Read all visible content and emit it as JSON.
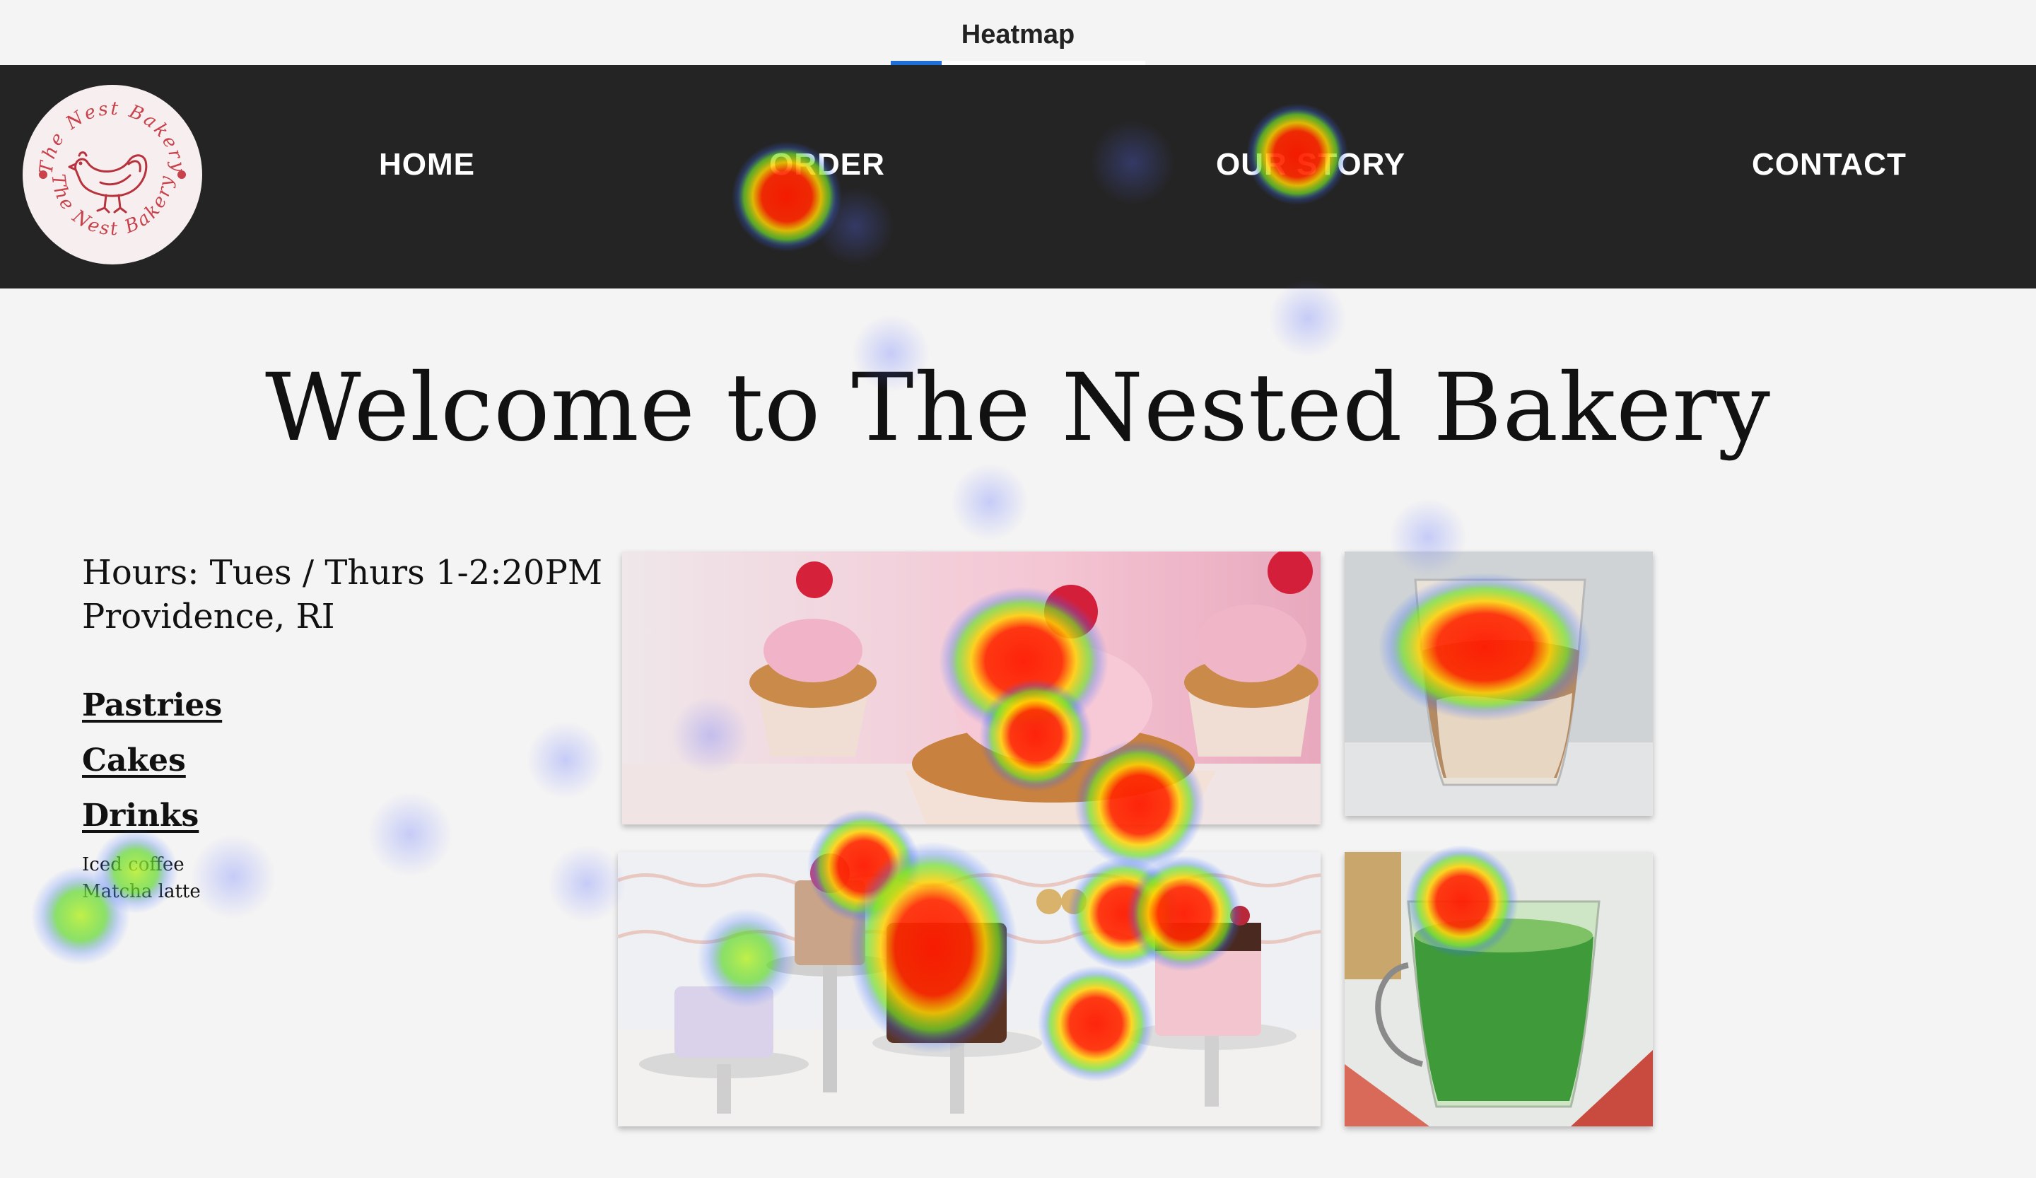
{
  "window": {
    "title": "Heatmap"
  },
  "nav": {
    "logo_text": "The Nest Bakery",
    "items": [
      "HOME",
      "ORDER",
      "OUR STORY",
      "CONTACT"
    ]
  },
  "main": {
    "headline": "Welcome to The Nested Bakery",
    "hours": "Hours: Tues / Thurs 1-2:20PM",
    "location": "Providence, RI",
    "categories": [
      "Pastries",
      "Cakes",
      "Drinks"
    ],
    "drinks": [
      "Iced coffee",
      "Matcha latte"
    ]
  },
  "colors": {
    "nav_bg": "#242424",
    "page_bg": "#f4f4f4",
    "logo_red": "#c8414b",
    "accent_blue": "#1f6fd6"
  }
}
